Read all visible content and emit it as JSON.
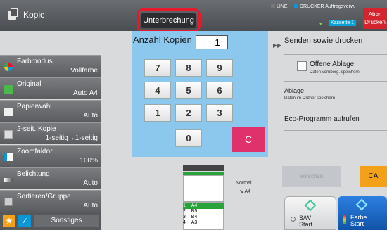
{
  "header": {
    "title": "Kopie",
    "interrupt_label": "Unterbrechung",
    "status_line": "LINE",
    "status_printer": "DRUCKER",
    "status_jobs": "Auftragsverw.",
    "cassette": "Kassette 1",
    "abort_label_1": "Abbr.",
    "abort_label_2": "Drucken"
  },
  "left_menu": [
    {
      "label": "Farbmodus",
      "value": "Vollfarbe",
      "icon": "color-mode-icon"
    },
    {
      "label": "Original",
      "value": "Auto  A4",
      "icon": "original-icon"
    },
    {
      "label": "Papierwahl",
      "value": "Auto",
      "icon": "paper-select-icon"
    },
    {
      "label": "2-seit. Kopie",
      "value": "1-seitig→1-seitig",
      "icon": "duplex-icon"
    },
    {
      "label": "Zoomfaktor",
      "value": "100%",
      "icon": "zoom-icon"
    },
    {
      "label": "Belichtung",
      "value": "Auto",
      "icon": "exposure-icon"
    },
    {
      "label": "Sortieren/Gruppe",
      "value": "Auto",
      "icon": "sort-group-icon"
    }
  ],
  "bottom": {
    "star": "★",
    "check": "✓",
    "other": "Sonstiges"
  },
  "keypad": {
    "label": "Anzahl Kopien",
    "value": "1",
    "keys": [
      "7",
      "8",
      "9",
      "4",
      "5",
      "6",
      "1",
      "2",
      "3",
      "0"
    ],
    "clear": "C"
  },
  "right_panel": {
    "send_copy": "Senden sowie drucken",
    "offline_title": "Offene Ablage",
    "offline_sub": "Daten vorüberg. speichern",
    "store_title": "Ablage",
    "store_sub": "Daten im Ordner speichern",
    "eco": "Eco-Programm aufrufen"
  },
  "preview": {
    "output_label": "Normal",
    "paper_size": "A4",
    "trays": [
      {
        "num": "1",
        "size": "A4"
      },
      {
        "num": "2",
        "size": "B5"
      },
      {
        "num": "3",
        "size": "B4"
      },
      {
        "num": "4",
        "size": "A3"
      }
    ]
  },
  "actions": {
    "mono_preview": "Vorschau",
    "ca": "CA",
    "bw_start_1": "S/W",
    "bw_start_2": "Start",
    "color_start_1": "Farbe",
    "color_start_2": "Start"
  },
  "colors": {
    "accent_blue": "#0a97d6",
    "interrupt_outline": "#e8192c",
    "clear_key": "#e0316c",
    "ca_button": "#f4a11a",
    "keypad_bg": "#8cc7ee"
  }
}
